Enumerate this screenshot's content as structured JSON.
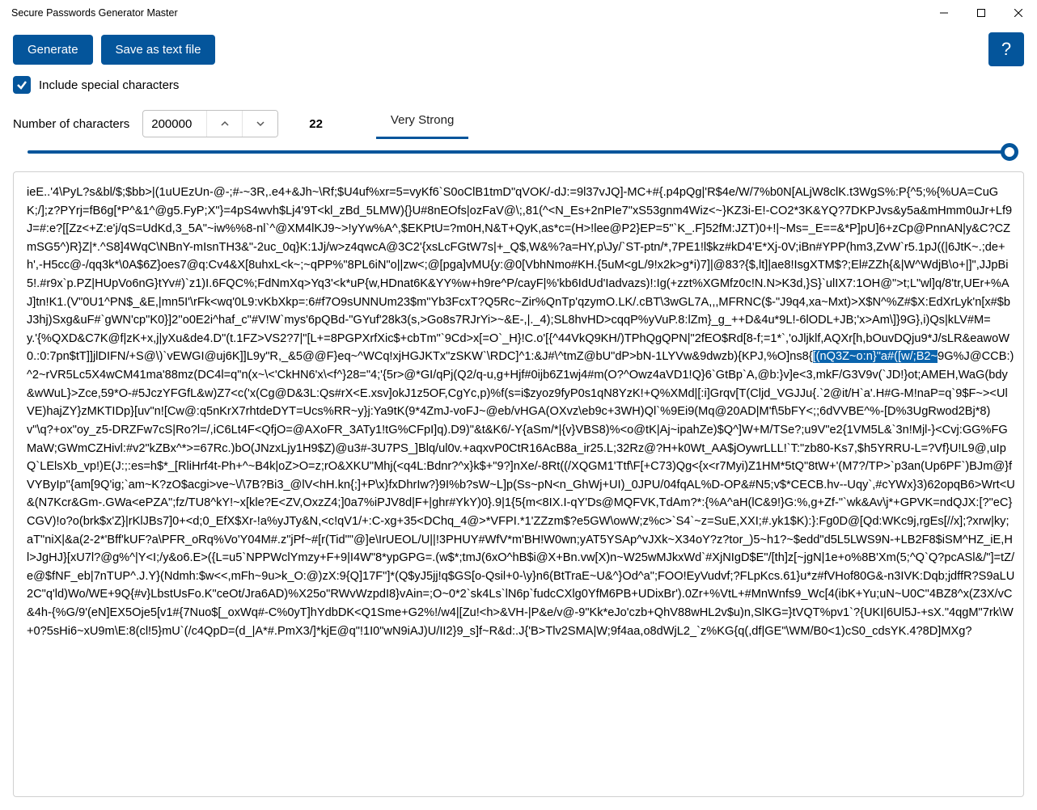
{
  "window": {
    "title": "Secure Passwords Generator Master"
  },
  "toolbar": {
    "generate_label": "Generate",
    "save_label": "Save as text file",
    "help_label": "?"
  },
  "options": {
    "include_special_label": "Include special characters",
    "include_special_checked": true
  },
  "params": {
    "num_chars_label": "Number of characters",
    "num_chars_value": "200000",
    "score": "22",
    "strength_label": "Very Strong"
  },
  "output": {
    "pre_selection": "ieE..'4\\PyL?s&bl/$;$bb>|(1uUEzUn-@-;#-~3R,.e4+&Jh~\\Rf;$U4uf%xr=5=vyKf6`S0oClB1tmD\"qVOK/-dJ:=9l37vJQ]-MC+#{.p4pQg|'R$4e/W/7%b0N[ALjW8clK.t3WgS%:P{^5;%{%UA=CuGK;/];z?PYrj=fB6g[*P^&1^@g5.FyP;X\"}=4pS4wvh$Lj4'9T<kl_zBd_5LMW){}U#8nEOfs|ozFaV@\\;,81(^<N_Es+2nPIe7\"xS53gnm4Wiz<~}KZ3i-E!-CO2*3K&YQ?7DKPJvs&y5a&mHmm0uJr+Lf9J=#:e?[[Zz<+Z:e'j/qS=UdKd,3_5A\"~iw%%8-nl`^@XM4lKJ9~>!yYw%A^,$EKPtU=?m0H,N&T+QyK,as*c=(H>!lee@P2}EP=5\"`K_.F]52fM:JZT)0+!|~Ms=_E==&*P]pU]6+zCp@PnnAN|y&C?CZmSG5^)R}Z|*.^S8]4WqC\\NBnY-mIsnTH3&\"-2uc_0q}K:1Jj/w>z4qwcA@3C2'{xsLcFGtW7s|+_Q$,W&%?a=HY,p\\Jy/`ST-ptn/*,7PE1!l$kz#kD4'E*Xj-0V;iBn#YPP(hm3,ZvW`r5.1pJ((|6JtK~.;de+h',-H5cc@-/qq3k*\\0A$6Z}oes7@q:Cv4&X[8uhxL<k~;~qPP%\"8PL6iN\"o||zw<;@[pga]vMU{y:@0[VbhNmo#KH.{5uM<gL/9!x2k>g*i)7]|@83?{$,lt]|ae8!IsgXTM$?;El#ZZh{&|W^WdjB\\o+|]\",JJpBi5!.#r9x`p.PZ|HUpVo6nG}tYv#)`z1)I.6FQC%;FdNmXq>Yq3'<k*uP{w,HDnat6K&YY%w+h9re^P/cayF|%'kb6IdUd'Iadvazs)!:Ig(+zzt%XGMfz0c!N.N>K3d,}S}`ulIX7:1OH@\">t;L\"wl]q/8'tr,UEr+%AJ]tn!K1.(V\"0U1^PN$_&E,|mn5I'\\rFk<wq'0L9:vKbXkp=:6#f7O9sUNNUm23$m\"Yb3FcxT?Q5Rc~Zir%QnTp'qzymO.LK/.cBT\\3wGL7A,,,MFRNC($-\"J9q4,xa~Mxt)>X$N^%Z#$X:EdXrLyk'n[x#$bJ3hj)Sxg&uF#`gWN'cp\"K0}]2''o0E2i^haf_c\"#V!W`mys'6pQBd-\"GYuf'28k3(s,>Go8s7RJrYi>~&E-,|._4);SL8hvHD>cqqP%yVuP.8:lZm}_g_++D&4u*9L!-6lODL+JB;'x>Am\\]}9G},i)Qs|kLV#M=y.'{%QXD&C7K@f|zK+x,j|yXu&de4.D\"(t.1FZ>VS2?7|\"[L+=8PGPXrfXic$+cbTm\"`9Cd>x[=O`_H}!C.o'[{^44VkQ9KH/)TPhQgQPN|\"2fEO$Rd[8-f;=1*`,'oJljklf,AQXr[h,bOuvDQju9*J/sLR&eawoW0.:0:7pn$tT]]jlDIFN/+S@\\)`vEWGI@uj6K]]L9y\"R,_&5@@F}eq~^WCq!xjHGJKTx\"zSKW`\\RDC]^1:&J#\\^tmZ@bU\"dP>bN-1LYVw&9dwzb){KPJ,%O]ns8{",
    "selection": "[(nQ3Z~o:n}\"a#([w/;B2~",
    "post_selection": "9G%J@CCB:)^2~rVR5Lc5X4wCM41ma'88mz(DC4l=q\"n(x~\\<'CkHN6'x\\<f^}28=\"4;'{5r>@*GI/qPj(Q2/q-u,g+Hjf#0ijb6Z1wj4#m(O?^Owz4aVD1!Q}6`GtBp`A,@b:}v]e<3,mkF/G3V9v(`JD!}ot;AMEH,WaG(bdy&wWuL}>Zce,59*O-#5JczYFGfL&w)Z7<c('x(Cg@D&3L:Qs#rX<E.xsv]okJ1z5OF,CgYc,p)%f(s=i$zyoz9fyP0s1qN8YzK!+Q%XMd|[:i]Grqv[T(Cljd_VGJJu{.`2@it/H`a'.H#G-M!naP=q`9$F~><UlVE)hajZY}zMKTIDp}[uv\"n![Cw@:q5nKrX7rhtdeDYT=Ucs%RR~y}j:Ya9tK(9*4ZmJ-voFJ~@eb/vHGA(OXvz\\eb9c+3WH)Ql`%9Ei9(Mq@20AD|M'f\\5bFY<;;6dVVBE^%-[D%3UgRwod2Bj*8)v\"\\q?+ox\"oy_z5-DRZFw7cS|Ro?l=/,iC6Lt4F<QfjO=@AXoFR_3ATy1!tG%CFpI]q).D9)\"&t&K6/-Y{aSm/*|{v}VBS8)%<o@tK|Aj~ipahZe)$Q^]W+M/TSe?;u9V\"e2{1VM5L&`3n!Mjl-}<Cvj:GG%FGMaW;GWmCZHivl:#v2\"kZBx^*>=67Rc.)bO(JNzxLjy1H9$Z)@u3#-3U7PS_]Blq/ul0v.+aqxvP0CtR16AcB8a_ir25.L;32Rz@?H+k0Wt_AA$jOywrLLL!`T:\"zb80-Ks7,$h5YRRU-L=?Vf}U!L9@,uIpQ`LElsXb_vp!)E(J:;:es=h$*_[RliHrf4t-Ph+^~B4k|oZ>O=z;rO&XKU\"Mhj(<q4L:Bdnr?^x}k$+\"9?]nXe/-8Rt((/XQGM1'Ttf\\F[+C73)Qg<{x<r7Myi)Z1HM*5tQ\"8tW+'(M7?/TP>`p3an(Up6PF`)BJm@}fVYByIp\"{am[9Q'ig;`am~K?zO$acgi>ve~\\/\\7B?Bi3_@lV<hH.kn{;]+P\\x}fxDhrIw?}9I%b?sW~L]p(Ss~pN<n_GhWj+UI)_0JPU/04fqAL%D-OP&#N5;v$*CECB.hv--Uqy`,#cYWx}3)62opqB6>Wrt<U&(N7Kcr&Gm-.GWa<ePZA\";fz/TU8^kY!~x[kle?E<ZV,OxzZ4;]0a7%iPJV8d|F+|ghr#YkY)0}.9|1{5{m<8IX.I-qY'Ds@MQFVK,TdAm?*:{%A^aH(lC&9!}G:%,g+Zf-\"`wk&Av\\j*+GPVK=ndQJX:[?\"eC}CGV)!o?o(brk$x'Z}|rKlJBs7]0+<d;0_EfX$Xr-!a%yJTy&N,<c!qV1/+:C-xg+35<DChq_4@>*VFPI.*1'ZZzm$?e5GW\\owW;z%c>`S4`~z=SuE,XXI;#.yk1$K):}:Fg0D@[Qd:WKc9j,rgEs[//x];?xrw|ky;aT\"niX|&a(2-2*'Bff'kUF?a\\PFR_oRq%Vo'Y04M#.z\"jPf~#[r(Tid\"\"@]e\\IrUEOL/U||!3PHUY#WfV*m'BH!W0wn;yAT5YSAp^vJXk~X34oY?z?tor_)5~h1?~$edd\"d5L5LWS9N-+LB2F8$iSM^HZ_iE,Hl>JgHJ}[xU7l?@g%^|Y<I;/y&o6.E>({L=u5`NPPWclYmzy+F+9|I4W\"8*ypGPG=.(w$*;tmJ(6xO^hB$i@X+Bn.vw[X)n~W25wMJkxWd`#XjNIgD$E\"/[th]z[~jgN|1e+o%8B'Xm(5;^Q`Q?pcASl&/\"]=tZ/e@$fNF_eb|7nTUP^.J.Y}(Ndmh:$w<<,mFh~9u>k_O:@)zX:9{Q]17F\"]*(Q$yJ5jj!q$GS[o-Qsil+0-\\y}n6(BtTraE~U&^}Od^a\";FOO!EyVudvf;?FLpKcs.61}u*z#fVHof80G&-n3IVK:Dqb;jdffR?S9aLU2C\"q'ld)Wo/WE+9Q{#v}LbstUsFo.K\"ceOt/Jra6AD)%X25o\"RWvWzpdI8}vAin=;O~0*2`sk4Ls`lN6p`fudcCXlg0YfM6PB+UDixBr').0Zr+%VtL+#MnWnfs9_Wc[4(ibK+Yu;uN~U0C\"4BZ8^x(Z3X/vC&4h-{%G/9'(eN]EX5Oje5[v1#{7Nuo$[_oxWq#-C%0yT]hYdbDK<Q1Sme+G2%!/w4|[Zu!<h>&VH-|P&e/v@-9\"Kk*eJo'czb+QhV88wHL2v$u)n,SlKG=}tVQT%pv1`?{UKI|6Ul5J-+sX.\"4qgM\"7rk\\W+0?5sHi6~xU9m\\E:8(cl!5}mU`(/c4QpD=(d_|A*#.PmX3/]*kjE@q\"!1I0\"wN9iAJ)U/II2}9_s]f~R&d:.J{'B>Tlv2SMA|W;9f4aa,o8dWjL2_`z%KG{q(,df|GE\"\\WM/B0<1)cS0_cdsYK.4?8D]MXg?"
  }
}
